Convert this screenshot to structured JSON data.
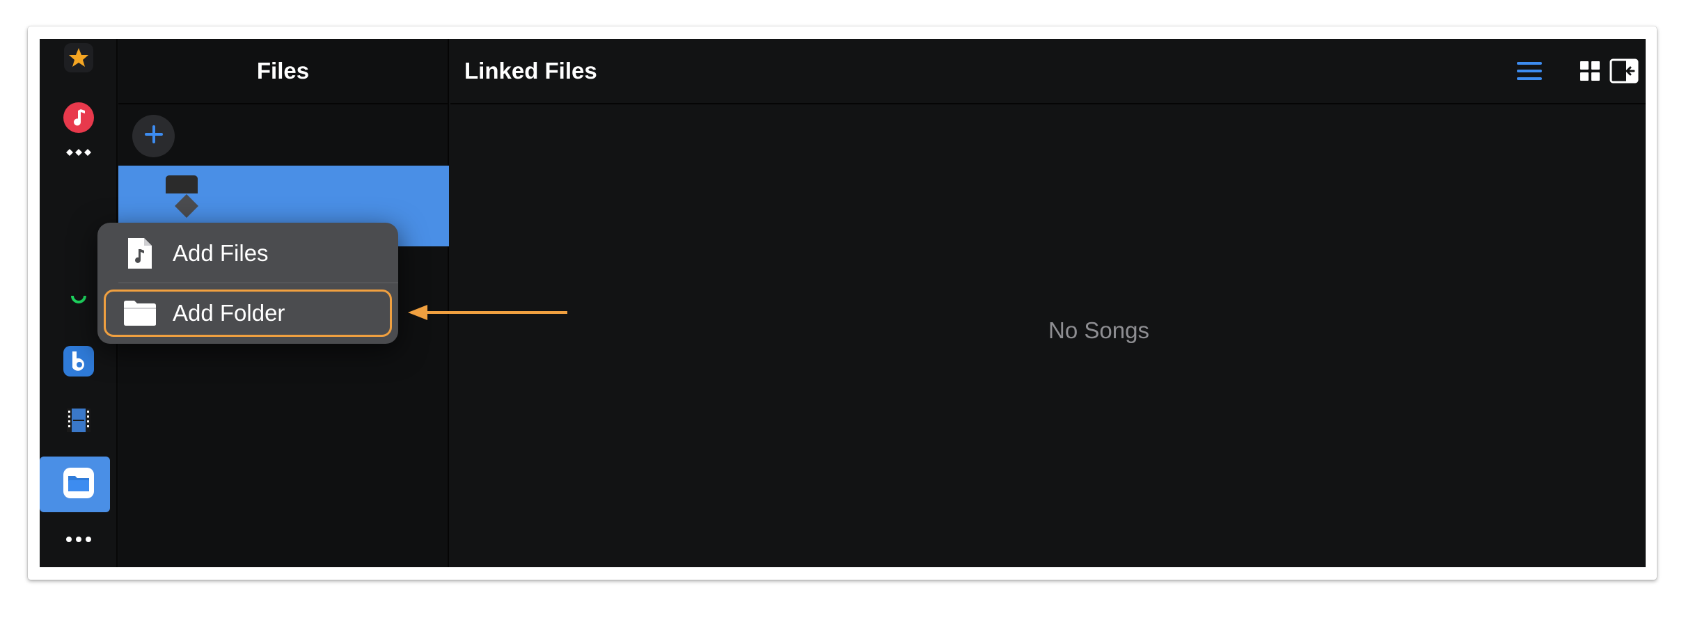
{
  "rail": {
    "items": [
      {
        "icon": "star-icon"
      },
      {
        "icon": "music-icon"
      },
      {
        "icon": "tidal-icon"
      },
      {
        "icon": "spotify-icon"
      },
      {
        "icon": "bandcamp-icon"
      },
      {
        "icon": "video-icon"
      },
      {
        "icon": "files-icon",
        "active": true
      },
      {
        "icon": "more-icon"
      }
    ]
  },
  "files": {
    "title": "Files",
    "add_icon": "plus-icon"
  },
  "main": {
    "title": "Linked Files",
    "empty_text": "No Songs",
    "toolbar": [
      "list-view-icon",
      "grid-view-icon",
      "collapse-sidebar-icon"
    ]
  },
  "popover": {
    "items": [
      {
        "label": "Add Files",
        "icon": "music-document-icon"
      },
      {
        "label": "Add Folder",
        "icon": "folder-icon",
        "highlighted": true
      }
    ]
  },
  "colors": {
    "accent": "#4a8fe6",
    "highlight": "#f0a040",
    "background": "#121314"
  }
}
